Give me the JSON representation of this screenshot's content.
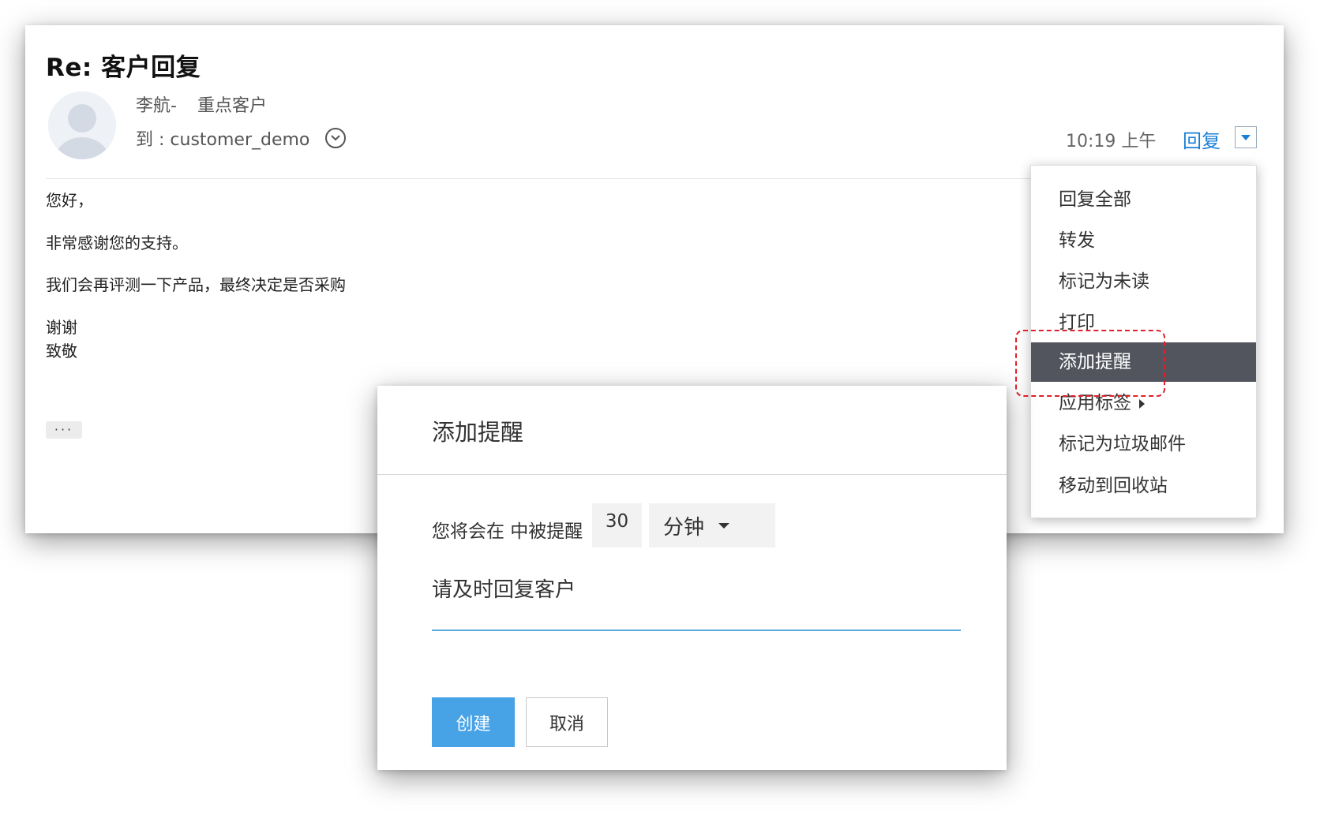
{
  "email": {
    "subject": "Re: 客户回复",
    "sender_name": "李航-",
    "sender_tag": "重点客户",
    "recipient": "到 : customer_demo",
    "time": "10:19 上午",
    "reply_label": "回复",
    "body": {
      "greeting": "您好，",
      "line1": "非常感谢您的支持。",
      "line2": "我们会再评测一下产品，最终决定是否采购",
      "closing1": "谢谢",
      "closing2": "致敬"
    },
    "more_label": "···"
  },
  "menu": {
    "items": [
      {
        "label": "回复全部"
      },
      {
        "label": "转发"
      },
      {
        "label": "标记为未读"
      },
      {
        "label": "打印"
      },
      {
        "label": "添加提醒"
      },
      {
        "label": "应用标签"
      },
      {
        "label": "标记为垃圾邮件"
      },
      {
        "label": "移动到回收站"
      }
    ],
    "active_index": 4
  },
  "dialog": {
    "title": "添加提醒",
    "prompt": "您将会在 中被提醒",
    "amount": "30",
    "unit": "分钟",
    "note": "请及时回复客户",
    "create_label": "创建",
    "cancel_label": "取消"
  },
  "colors": {
    "accent": "#1a7fd3",
    "create_button": "#47a2e6",
    "active_menu_bg": "#52555e",
    "highlight_border": "#e0202a",
    "input_underline": "#5aa9de"
  },
  "icons": {
    "avatar": "person-placeholder-icon",
    "expand": "chevron-down-circle-icon",
    "reply_dropdown": "caret-down-icon",
    "submenu": "caret-right-icon",
    "unit_dropdown": "caret-down-icon"
  }
}
